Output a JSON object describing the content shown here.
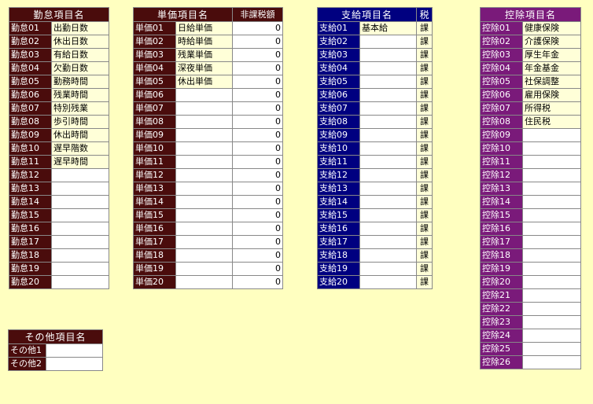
{
  "attendance": {
    "header": "勤怠項目名",
    "rows": [
      {
        "code": "勤怠01",
        "name": "出勤日数"
      },
      {
        "code": "勤怠02",
        "name": "休出日数"
      },
      {
        "code": "勤怠03",
        "name": "有給日数"
      },
      {
        "code": "勤怠04",
        "name": "欠勤日数"
      },
      {
        "code": "勤怠05",
        "name": "勤務時間"
      },
      {
        "code": "勤怠06",
        "name": "残業時間"
      },
      {
        "code": "勤怠07",
        "name": "特別残業"
      },
      {
        "code": "勤怠08",
        "name": "歩引時間"
      },
      {
        "code": "勤怠09",
        "name": "休出時間"
      },
      {
        "code": "勤怠10",
        "name": "遅早階数"
      },
      {
        "code": "勤怠11",
        "name": "遅早時間"
      },
      {
        "code": "勤怠12",
        "name": ""
      },
      {
        "code": "勤怠13",
        "name": ""
      },
      {
        "code": "勤怠14",
        "name": ""
      },
      {
        "code": "勤怠15",
        "name": ""
      },
      {
        "code": "勤怠16",
        "name": ""
      },
      {
        "code": "勤怠17",
        "name": ""
      },
      {
        "code": "勤怠18",
        "name": ""
      },
      {
        "code": "勤怠19",
        "name": ""
      },
      {
        "code": "勤怠20",
        "name": ""
      }
    ]
  },
  "unit_price": {
    "header": "単価項目名",
    "header2": "非課税額",
    "rows": [
      {
        "code": "単価01",
        "name": "日給単価",
        "amount": "0"
      },
      {
        "code": "単価02",
        "name": "時給単価",
        "amount": "0"
      },
      {
        "code": "単価03",
        "name": "残業単価",
        "amount": "0"
      },
      {
        "code": "単価04",
        "name": "深夜単価",
        "amount": "0"
      },
      {
        "code": "単価05",
        "name": "休出単価",
        "amount": "0"
      },
      {
        "code": "単価06",
        "name": "",
        "amount": "0"
      },
      {
        "code": "単価07",
        "name": "",
        "amount": "0"
      },
      {
        "code": "単価08",
        "name": "",
        "amount": "0"
      },
      {
        "code": "単価09",
        "name": "",
        "amount": "0"
      },
      {
        "code": "単価10",
        "name": "",
        "amount": "0"
      },
      {
        "code": "単価11",
        "name": "",
        "amount": "0"
      },
      {
        "code": "単価12",
        "name": "",
        "amount": "0"
      },
      {
        "code": "単価13",
        "name": "",
        "amount": "0"
      },
      {
        "code": "単価14",
        "name": "",
        "amount": "0"
      },
      {
        "code": "単価15",
        "name": "",
        "amount": "0"
      },
      {
        "code": "単価16",
        "name": "",
        "amount": "0"
      },
      {
        "code": "単価17",
        "name": "",
        "amount": "0"
      },
      {
        "code": "単価18",
        "name": "",
        "amount": "0"
      },
      {
        "code": "単価19",
        "name": "",
        "amount": "0"
      },
      {
        "code": "単価20",
        "name": "",
        "amount": "0"
      }
    ]
  },
  "payment": {
    "header": "支給項目名",
    "header2": "税",
    "rows": [
      {
        "code": "支給01",
        "name": "基本給",
        "tax": "課"
      },
      {
        "code": "支給02",
        "name": "",
        "tax": "課"
      },
      {
        "code": "支給03",
        "name": "",
        "tax": "課"
      },
      {
        "code": "支給04",
        "name": "",
        "tax": "課"
      },
      {
        "code": "支給05",
        "name": "",
        "tax": "課"
      },
      {
        "code": "支給06",
        "name": "",
        "tax": "課"
      },
      {
        "code": "支給07",
        "name": "",
        "tax": "課"
      },
      {
        "code": "支給08",
        "name": "",
        "tax": "課"
      },
      {
        "code": "支給09",
        "name": "",
        "tax": "課"
      },
      {
        "code": "支給10",
        "name": "",
        "tax": "課"
      },
      {
        "code": "支給11",
        "name": "",
        "tax": "課"
      },
      {
        "code": "支給12",
        "name": "",
        "tax": "課"
      },
      {
        "code": "支給13",
        "name": "",
        "tax": "課"
      },
      {
        "code": "支給14",
        "name": "",
        "tax": "課"
      },
      {
        "code": "支給15",
        "name": "",
        "tax": "課"
      },
      {
        "code": "支給16",
        "name": "",
        "tax": "課"
      },
      {
        "code": "支給17",
        "name": "",
        "tax": "課"
      },
      {
        "code": "支給18",
        "name": "",
        "tax": "課"
      },
      {
        "code": "支給19",
        "name": "",
        "tax": "課"
      },
      {
        "code": "支給20",
        "name": "",
        "tax": "課"
      }
    ]
  },
  "deduction": {
    "header": "控除項目名",
    "rows": [
      {
        "code": "控除01",
        "name": "健康保険"
      },
      {
        "code": "控除02",
        "name": "介護保険"
      },
      {
        "code": "控除03",
        "name": "厚生年金"
      },
      {
        "code": "控除04",
        "name": "年金基金"
      },
      {
        "code": "控除05",
        "name": "社保調整"
      },
      {
        "code": "控除06",
        "name": "雇用保険"
      },
      {
        "code": "控除07",
        "name": "所得税"
      },
      {
        "code": "控除08",
        "name": "住民税"
      },
      {
        "code": "控除09",
        "name": ""
      },
      {
        "code": "控除10",
        "name": ""
      },
      {
        "code": "控除11",
        "name": ""
      },
      {
        "code": "控除12",
        "name": ""
      },
      {
        "code": "控除13",
        "name": ""
      },
      {
        "code": "控除14",
        "name": ""
      },
      {
        "code": "控除15",
        "name": ""
      },
      {
        "code": "控除16",
        "name": ""
      },
      {
        "code": "控除17",
        "name": ""
      },
      {
        "code": "控除18",
        "name": ""
      },
      {
        "code": "控除19",
        "name": ""
      },
      {
        "code": "控除20",
        "name": ""
      },
      {
        "code": "控除21",
        "name": ""
      },
      {
        "code": "控除22",
        "name": ""
      },
      {
        "code": "控除23",
        "name": ""
      },
      {
        "code": "控除24",
        "name": ""
      },
      {
        "code": "控除25",
        "name": ""
      },
      {
        "code": "控除26",
        "name": ""
      }
    ]
  },
  "other": {
    "header": "その他項目名",
    "rows": [
      {
        "code": "その他1",
        "name": ""
      },
      {
        "code": "その他2",
        "name": ""
      }
    ]
  }
}
